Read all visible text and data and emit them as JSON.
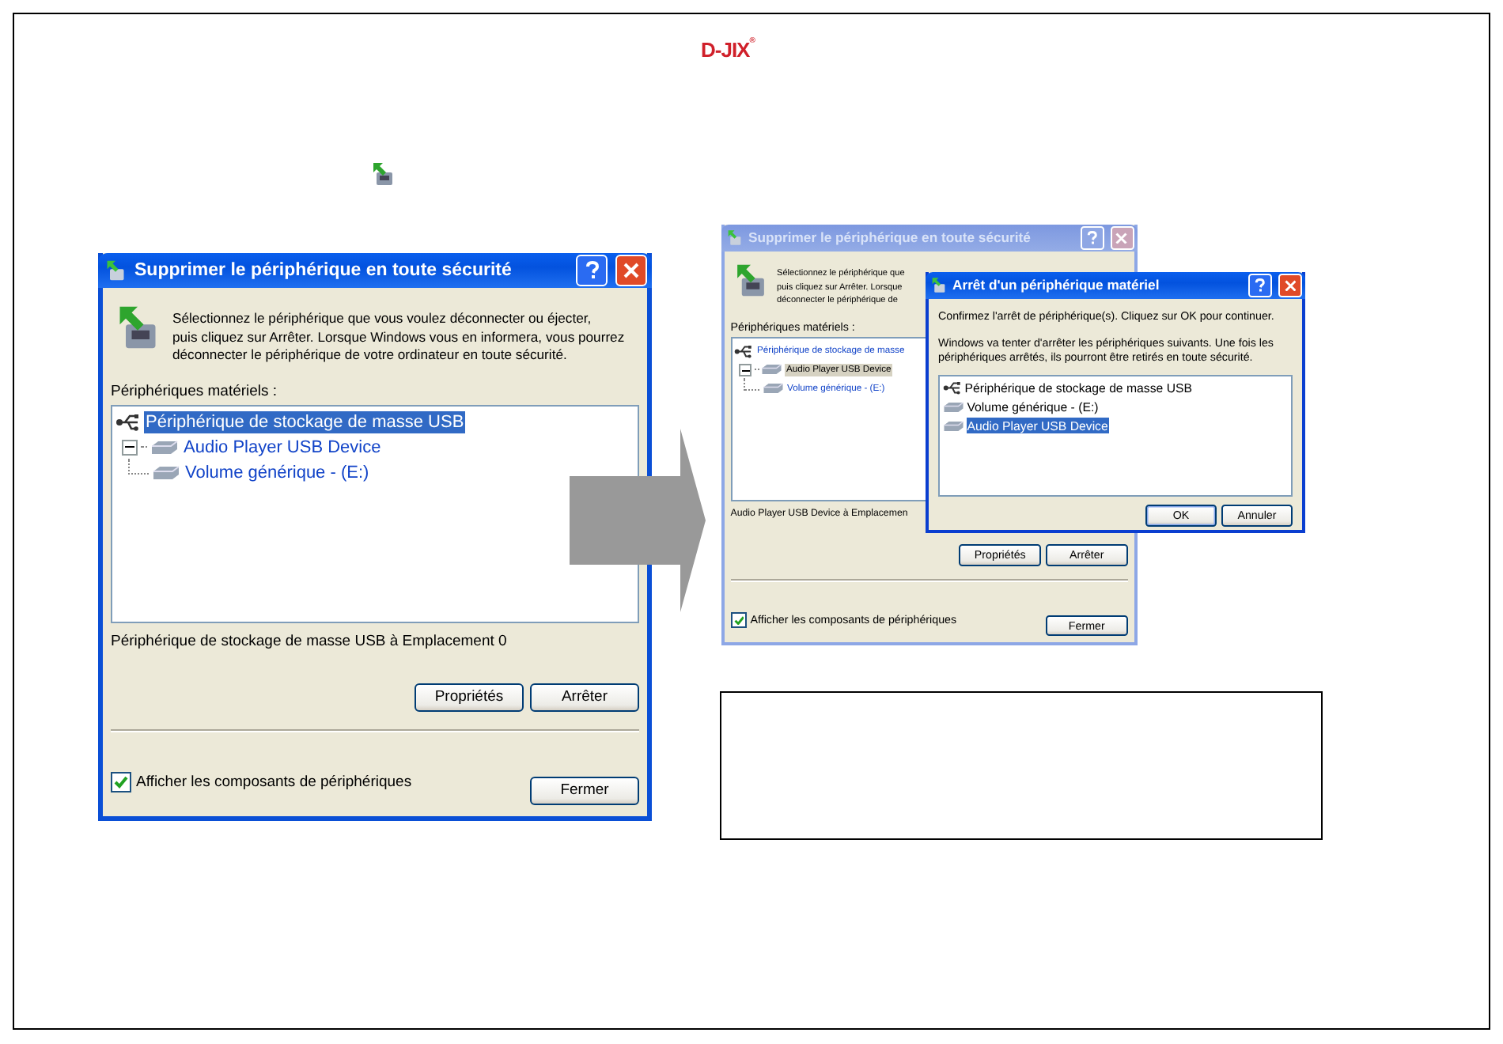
{
  "logo": {
    "text": "D-JIX",
    "mark": "®"
  },
  "dialogs": [
    {
      "active": true,
      "title": "Supprimer le périphérique en toute sécurité",
      "instruction_lines": [
        "Sélectionnez le périphérique que vous voulez déconnecter ou éjecter,",
        "puis cliquez sur Arrêter. Lorsque Windows vous en informera, vous pourrez",
        "déconnecter le périphérique de votre ordinateur en toute sécurité."
      ],
      "list_label": "Périphériques matériels :",
      "devices": [
        {
          "kind": "controller",
          "label": "Périphérique de stockage de masse USB",
          "selected": true,
          "children": [
            {
              "kind": "device",
              "label": "Audio Player USB Device",
              "selected": false,
              "expanded": true,
              "children": [
                {
                  "kind": "device",
                  "label": "Volume générique - (E:)",
                  "selected": false
                }
              ]
            }
          ]
        }
      ],
      "status": "Périphérique de stockage de masse USB à Emplacement 0",
      "buttons": [
        "Propriétés",
        "Arrêter"
      ],
      "show_components": {
        "label": "Afficher les composants de périphériques",
        "checked": true
      },
      "close_button": "Fermer"
    },
    {
      "active": false,
      "title": "Supprimer le périphérique en toute sécurité",
      "instruction_lines": [
        "Sélectionnez le périphérique que",
        "puis cliquez sur Arrêter. Lorsque",
        "déconnecter le périphérique de"
      ],
      "list_label": "Périphériques matériels :",
      "devices": [
        {
          "kind": "controller",
          "label": "Périphérique de stockage de masse",
          "selected": false,
          "children": [
            {
              "kind": "device",
              "label": "Audio Player USB Device",
              "selected": true,
              "expanded": true,
              "children": [
                {
                  "kind": "device",
                  "label": "Volume générique - (E:)",
                  "selected": false
                }
              ]
            }
          ]
        }
      ],
      "status": "Audio Player USB Device à Emplacemen",
      "buttons": [
        "Propriétés",
        "Arrêter"
      ],
      "show_components": {
        "label": "Afficher les composants de périphériques",
        "checked": true
      },
      "close_button": "Fermer"
    }
  ],
  "confirm_dialog": {
    "title": "Arrêt d'un périphérique matériel",
    "message": "Confirmez l'arrêt de périphérique(s). Cliquez sur OK pour continuer.",
    "explanation": "Windows va tenter d'arrêter les périphériques suivants. Une fois les périphériques arrêtés, ils pourront être retirés en toute sécurité.",
    "devices": [
      {
        "kind": "controller",
        "label": "Périphérique de stockage de masse USB",
        "selected": false
      },
      {
        "kind": "device",
        "label": "Volume générique - (E:)",
        "selected": false
      },
      {
        "kind": "device",
        "label": "Audio Player USB Device",
        "selected": true
      }
    ],
    "buttons": [
      "OK",
      "Annuler"
    ]
  }
}
